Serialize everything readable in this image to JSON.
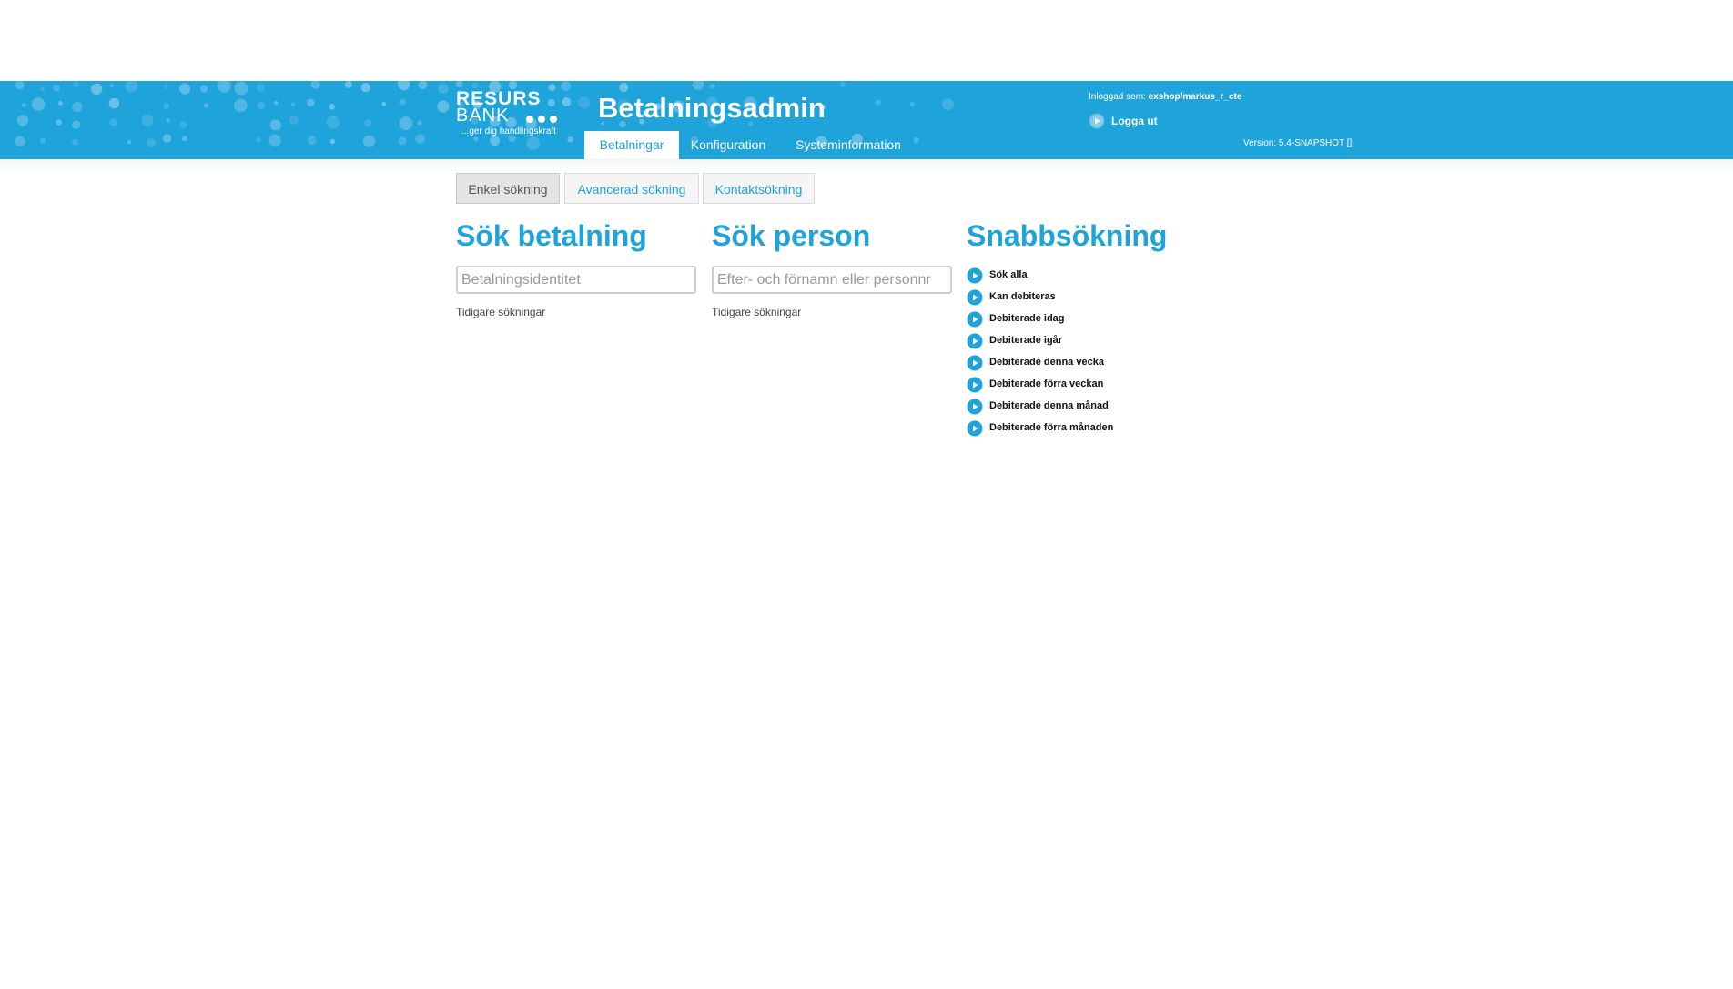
{
  "logo": {
    "line1": "RESURS",
    "line2": "BANK",
    "tagline": "...ger dig handlingskraft"
  },
  "app_title": "Betalningsadmin",
  "main_nav": [
    {
      "label": "Betalningar",
      "active": true
    },
    {
      "label": "Konfiguration",
      "active": false
    },
    {
      "label": "Systeminformation",
      "active": false
    }
  ],
  "user": {
    "logged_in_label": "Inloggad som:",
    "username": "exshop/markus_r_cte",
    "logout_label": "Logga ut",
    "version": "Version: 5.4-SNAPSHOT []"
  },
  "sub_tabs": [
    {
      "label": "Enkel sökning",
      "active": true
    },
    {
      "label": "Avancerad sökning",
      "active": false
    },
    {
      "label": "Kontaktsökning",
      "active": false
    }
  ],
  "payment_search": {
    "title": "Sök betalning",
    "placeholder": "Betalningsidentitet",
    "value": "",
    "previous_label": "Tidigare sökningar"
  },
  "person_search": {
    "title": "Sök person",
    "placeholder": "Efter- och förnamn eller personnr",
    "value": "",
    "previous_label": "Tidigare sökningar"
  },
  "quick_search": {
    "title": "Snabbsökning",
    "items": [
      "Sök alla",
      "Kan debiteras",
      "Debiterade idag",
      "Debiterade igår",
      "Debiterade denna vecka",
      "Debiterade förra veckan",
      "Debiterade denna månad",
      "Debiterade förra månaden"
    ]
  },
  "colors": {
    "brand_blue": "#1ea3db",
    "white": "#ffffff"
  },
  "icons": {
    "play": "play-circle-icon"
  }
}
